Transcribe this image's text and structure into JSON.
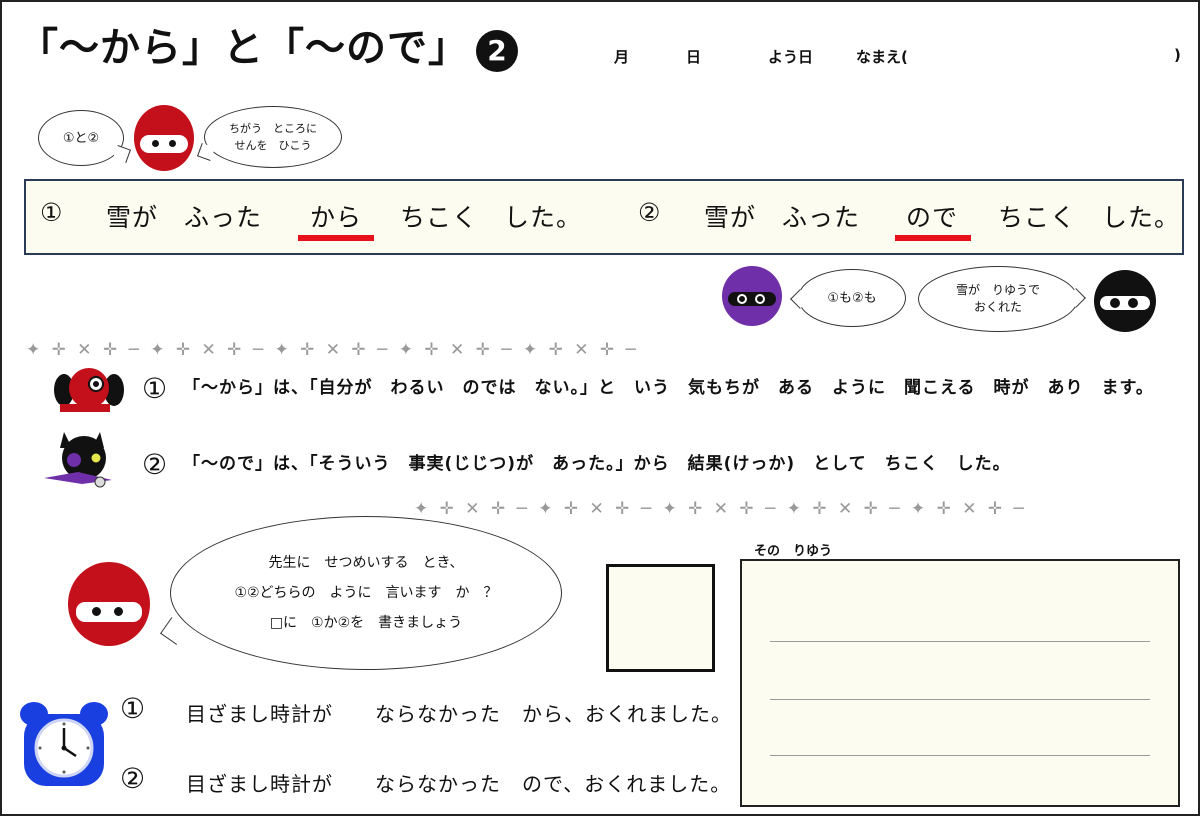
{
  "header": {
    "title": "「〜から」と「〜ので」",
    "number": "2",
    "month_label": "月",
    "day_label": "日",
    "weekday_label": "よう日",
    "name_label": "なまえ(",
    "name_close": ")"
  },
  "top_dialog": {
    "left_bubble": "①と②",
    "right_bubble_line1": "ちがう　ところに",
    "right_bubble_line2": "せんを　ひこう"
  },
  "examples": {
    "ex1_num": "①",
    "ex1_before": "雪が　ふった",
    "ex1_key": "から",
    "ex1_after": "ちこく　した。",
    "ex2_num": "②",
    "ex2_before": "雪が　ふった",
    "ex2_key": "ので",
    "ex2_after": "ちこく　した。",
    "underline_color": "#e8101a"
  },
  "mid_dialog": {
    "bubble1": "①も②も",
    "bubble2_line1": "雪が　りゆうで",
    "bubble2_line2": "おくれた"
  },
  "separators": {
    "upper": "✦ ✛ ✕ ✛ ─ ✦ ✛ ✕ ✛ ─ ✦ ✛ ✕ ✛ ─ ✦ ✛ ✕ ✛ ─ ✦ ✛ ✕ ✛ ─",
    "lower": "✦ ✛ ✕ ✛ ─ ✦ ✛ ✕ ✛ ─ ✦ ✛ ✕ ✛ ─ ✦ ✛ ✕ ✛ ─ ✦ ✛ ✕ ✛ ─"
  },
  "explanations": {
    "exp1_num": "①",
    "exp1_text": "「〜から」は、「自分が　わるい　のでは　ない。」と　いう　気もちが　ある　ように　聞こえる　時が　あり　ます。",
    "exp2_num": "②",
    "exp2_text": "「〜ので」は、「そういう　事実(じじつ)が　あった。」から　結果(けっか)　として　ちこく　した。"
  },
  "question_bubble": {
    "line1": "先生に　せつめいする　とき、",
    "line2": "①②どちらの　ように　言います　か　？",
    "line3": "□に　①か②を　書きましょう"
  },
  "reason": {
    "label": "その　りゆう"
  },
  "questions": {
    "q1_num": "①",
    "q1_text": "目ざまし時計が　　ならなかった　から、おくれました。",
    "q2_num": "②",
    "q2_text": "目ざまし時計が　　ならなかった　ので、おくれました。"
  },
  "colors": {
    "red_ninja": "#c3101a",
    "purple_ninja": "#6f2fa8",
    "black_ninja": "#111111",
    "clock": "#1a3fe0",
    "box_fill": "#fdfcf0",
    "box_border": "#2a3b55"
  }
}
